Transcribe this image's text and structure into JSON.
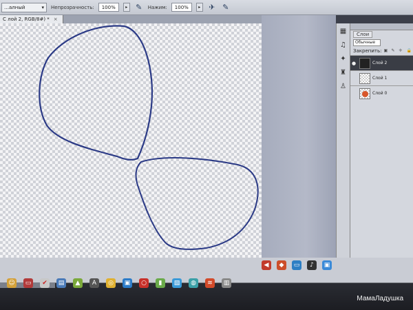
{
  "options_bar": {
    "tool_preset": "…алный",
    "opacity_label": "Непрозрачность:",
    "opacity_value": "100%",
    "flow_label": "Нажим:",
    "flow_value": "100%"
  },
  "document": {
    "tab_title": "С лой 2, RGB/8#) *",
    "tab_close": "×"
  },
  "layers_panel": {
    "tab_label": "Слои",
    "blend_mode": "Обычные",
    "lock_label": "Закрепить:",
    "layers": [
      {
        "name": "Слой 2",
        "selected": true
      },
      {
        "name": "Слой 1",
        "selected": false
      },
      {
        "name": "Слой 0",
        "selected": false
      }
    ]
  },
  "watermark": "МамаЛадушка",
  "colors": {
    "stroke": "#2b3a86",
    "taskbar_dark": "#1c1d22"
  }
}
